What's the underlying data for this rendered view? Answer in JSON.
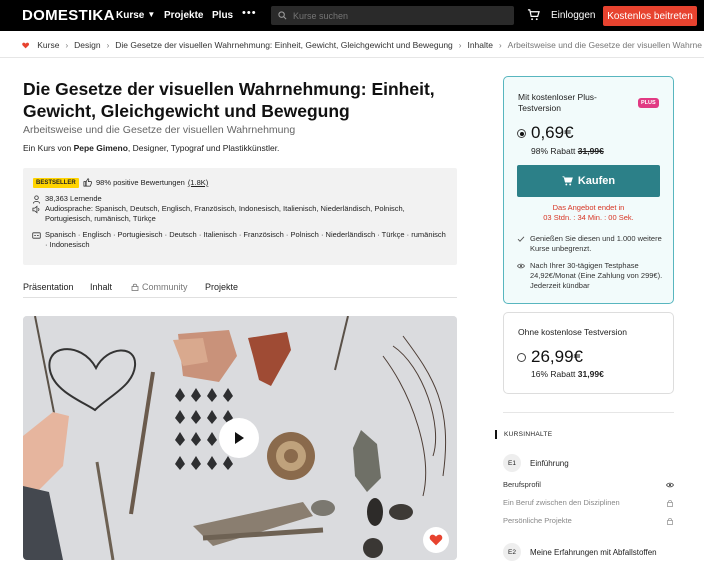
{
  "nav": {
    "logo": "DOMESTIKA",
    "kurse": "Kurse",
    "projekte": "Projekte",
    "plus": "Plus",
    "more": "•••",
    "search_placeholder": "Kurse suchen",
    "login": "Einloggen",
    "cta": "Kostenlos beitreten"
  },
  "breadcrumb": [
    "Kurse",
    "Design",
    "Die Gesetze der visuellen Wahrnehmung: Einheit, Gewicht, Gleichgewicht und Bewegung",
    "Inhalte",
    "Arbeitsweise und die Gesetze der visuellen Wahrne"
  ],
  "course": {
    "title": "Die Gesetze der visuellen Wahrnehmung: Einheit, Gewicht, Gleichgewicht und Bewegung",
    "subtitle": "Arbeitsweise und die Gesetze der visuellen Wahrnehmung",
    "byline_prefix": "Ein Kurs von",
    "author": "Pepe Gimeno",
    "byline_suffix": ", Designer, Typograf und Plastikkünstler."
  },
  "info": {
    "badge": "BESTSELLER",
    "rating_text": "98% positive Bewertungen",
    "rating_count": "(1.8K)",
    "learners": "38,363 Lernende",
    "audio": "Audiosprache: Spanisch, Deutsch, Englisch, Französisch, Indonesisch, Italienisch, Niederländisch, Polnisch, Portugiesisch, rumänisch, Türkçe",
    "subtitles": "Spanisch · Englisch · Portugiesisch · Deutsch · Italienisch · Französisch · Polnisch · Niederländisch · Türkçe · rumänisch · Indonesisch"
  },
  "tabs": [
    "Präsentation",
    "Inhalt",
    "Community",
    "Projekte"
  ],
  "plus_card": {
    "title": "Mit kostenloser Plus-Testversion",
    "badge": "PLUS",
    "price": "0,69€",
    "discount": "98% Rabatt",
    "old_price": "31,99€",
    "buy": "Kaufen",
    "offer_line1": "Das Angebot endet in",
    "offer_line2": "03 Stdn. : 34 Min. : 00 Sek.",
    "feature1": "Genießen Sie diesen und 1.000 weitere Kurse unbegrenzt.",
    "feature2": "Nach Ihrer 30-tägigen Testphase 24,92€/Monat (Eine Zahlung von 299€). Jederzeit kündbar"
  },
  "regular_card": {
    "title": "Ohne kostenlose Testversion",
    "price": "26,99€",
    "discount": "16% Rabatt",
    "old_price": "31,99€"
  },
  "contents": {
    "heading": "KURSINHALTE",
    "chapters": [
      {
        "num": "E1",
        "title": "Einführung"
      },
      {
        "num": "E2",
        "title": "Meine Erfahrungen mit Abfallstoffen"
      }
    ],
    "lessons": [
      "Berufsprofil",
      "Ein Beruf zwischen den Disziplinen",
      "Persönliche Projekte"
    ]
  },
  "colors": {
    "accent": "#e7432f",
    "teal": "#2c8088",
    "plus_pink": "#e13a83",
    "offer_red": "#d73524"
  }
}
